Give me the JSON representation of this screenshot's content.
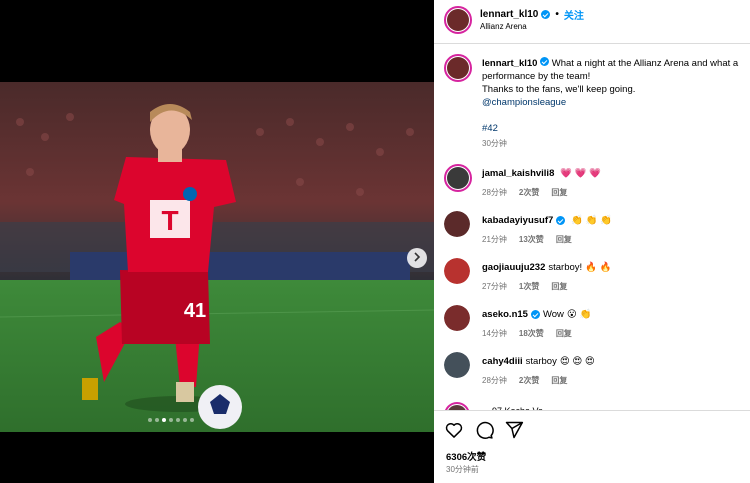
{
  "post": {
    "username": "lennart_kl10",
    "follow_label": "关注",
    "location": "Allianz Arena",
    "caption_line1": "What a night at the Allianz Arena and what a performance by the team!",
    "caption_line2": "Thanks to the fans, we'll keep going.",
    "mention": "@championsleague",
    "hashtag": "#42",
    "caption_time": "30分钟",
    "likes": "6306次赞",
    "posted_ago": "30分钟前",
    "carousel": {
      "count": 7,
      "current": 3
    }
  },
  "comments": [
    {
      "username": "jamal_kaishvili8",
      "verified": false,
      "text": "",
      "emoji": "💗 💗 💗",
      "time": "28分钟",
      "likes": "2次赞",
      "reply": "回复",
      "avatar_color": "#3a3a3a"
    },
    {
      "username": "kabadayiyusuf7",
      "verified": true,
      "text": "",
      "emoji": "👏 👏 👏",
      "time": "21分钟",
      "likes": "13次赞",
      "reply": "回复",
      "avatar_color": "#5b2a2a"
    },
    {
      "username": "gaojiauuju232",
      "verified": false,
      "text": "starboy!",
      "emoji": "🔥 🔥",
      "time": "27分钟",
      "likes": "1次赞",
      "reply": "回复",
      "avatar_color": "#b8322f"
    },
    {
      "username": "aseko.n15",
      "verified": true,
      "text": "Wow",
      "emoji": "😮 👏",
      "time": "14分钟",
      "likes": "18次赞",
      "reply": "回复",
      "avatar_color": "#7a2c2c"
    },
    {
      "username": "cahy4diii",
      "verified": false,
      "text": "starboy",
      "emoji": "😍 😍 😍",
      "time": "28分钟",
      "likes": "2次赞",
      "reply": "回复",
      "avatar_color": "#44505a"
    }
  ],
  "partial_comment": "... 97 Kocha Ve ...",
  "colors": {
    "accent": "#0095f6",
    "ring": "#d6249f",
    "jersey": "#dc052d"
  },
  "icons": [
    "heart-icon",
    "comment-icon",
    "share-icon",
    "chevron-right-icon",
    "verified-badge-icon"
  ]
}
